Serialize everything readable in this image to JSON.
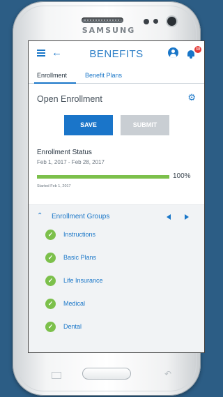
{
  "device": {
    "brand": "SAMSUNG"
  },
  "appbar": {
    "title": "BENEFITS",
    "notification_count": "38"
  },
  "tabs": [
    {
      "label": "Enrollment",
      "active": true
    },
    {
      "label": "Benefit Plans",
      "active": false
    }
  ],
  "section": {
    "title": "Open Enrollment"
  },
  "actions": {
    "save_label": "SAVE",
    "submit_label": "SUBMIT"
  },
  "status": {
    "title": "Enrollment Status",
    "dates": "Feb 1, 2017 - Feb 28, 2017",
    "progress_value": 100,
    "progress_label": "100%",
    "started": "Started Feb 1, 2017"
  },
  "groups": {
    "title": "Enrollment Groups",
    "items": [
      {
        "label": "Instructions"
      },
      {
        "label": "Basic Plans"
      },
      {
        "label": "Life Insurance"
      },
      {
        "label": "Medical"
      },
      {
        "label": "Dental"
      }
    ]
  },
  "colors": {
    "accent": "#1976c8",
    "success": "#7cc04b",
    "disabled": "#c9ced3",
    "background": "#2c5d85"
  },
  "icons": [
    "menu-icon",
    "back-arrow-icon",
    "user-icon",
    "bell-icon",
    "gear-icon",
    "chevron-up-icon",
    "prev-icon",
    "next-icon",
    "check-icon"
  ]
}
